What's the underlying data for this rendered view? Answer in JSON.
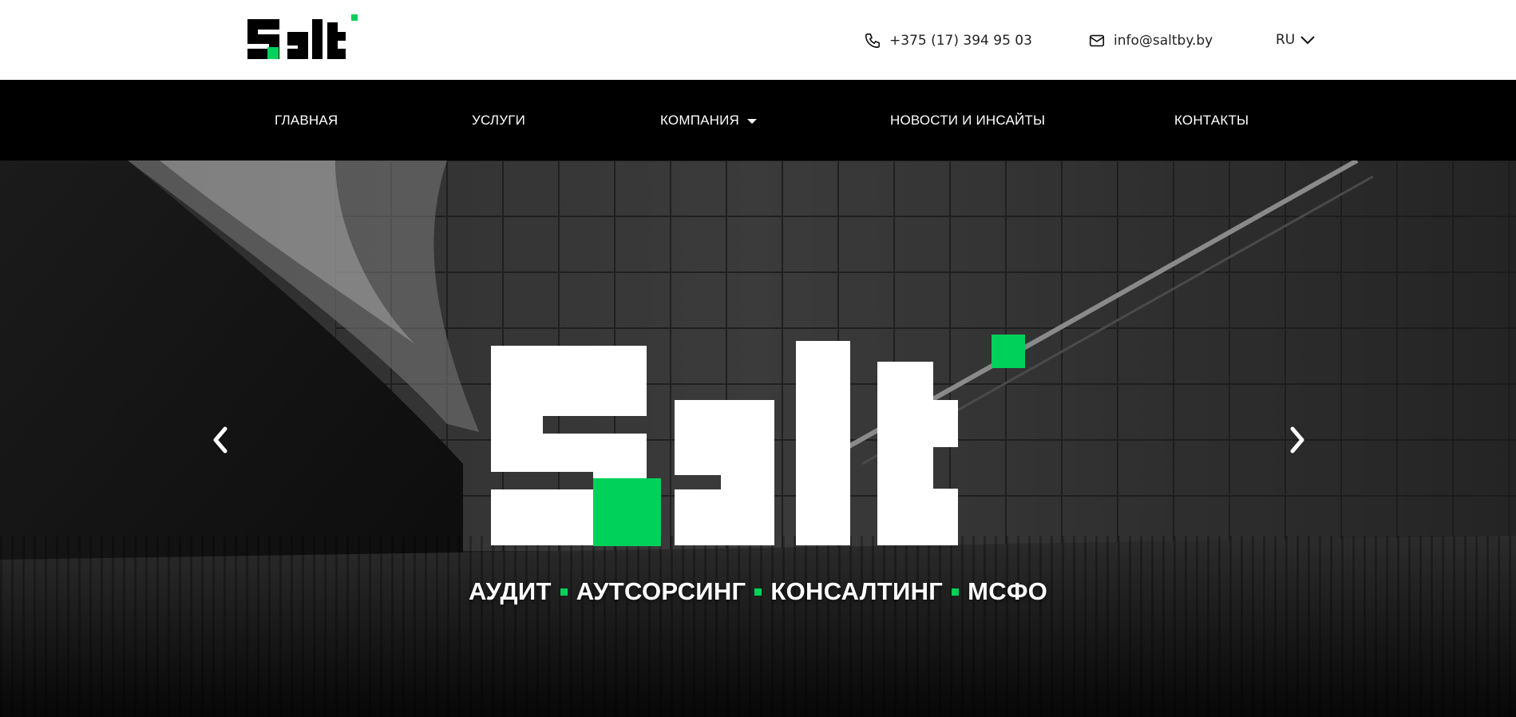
{
  "brand": {
    "name": "Salt",
    "accent_color": "#00d15a"
  },
  "header": {
    "phone": "+375 (17) 394 95 03",
    "email": "info@saltby.by",
    "language": "RU",
    "icons": {
      "phone": "phone-icon",
      "email": "envelope-icon",
      "language_toggle": "chevron-down-icon"
    }
  },
  "nav": {
    "items": [
      {
        "label": "ГЛАВНАЯ"
      },
      {
        "label": "УСЛУГИ"
      },
      {
        "label": "КОМПАНИЯ",
        "has_dropdown": true
      },
      {
        "label": "НОВОСТИ И ИНСАЙТЫ"
      },
      {
        "label": "КОНТАКТЫ"
      }
    ]
  },
  "hero": {
    "slogan": [
      "АУДИТ",
      "АУТСОРСИНГ",
      "КОНСАЛТИНГ",
      "МСФО"
    ],
    "icons": {
      "prev": "chevron-left-icon",
      "next": "chevron-right-icon"
    }
  }
}
